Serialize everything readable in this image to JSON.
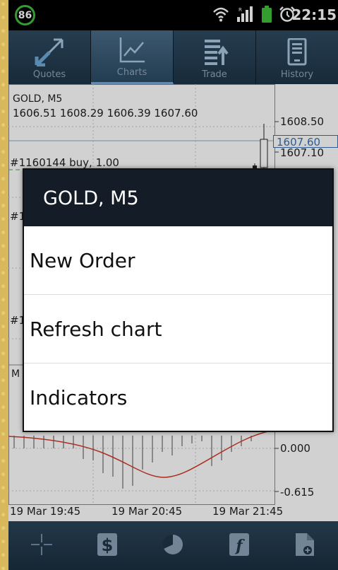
{
  "status_bar": {
    "battery_level": "86",
    "time": "22:15",
    "icons": [
      "wifi-icon",
      "signal-icon",
      "battery-icon",
      "alarm-icon"
    ]
  },
  "tabs": [
    {
      "label": "Quotes",
      "icon": "quotes-icon",
      "active": false
    },
    {
      "label": "Charts",
      "icon": "chart-icon",
      "active": true
    },
    {
      "label": "Trade",
      "icon": "trade-icon",
      "active": false
    },
    {
      "label": "History",
      "icon": "history-icon",
      "active": false
    }
  ],
  "chart": {
    "symbol_timeframe": "GOLD, M5",
    "ohlc": "1606.51 1608.29 1606.39 1607.60",
    "order_line_label": "#1160144 buy, 1.00",
    "partial_labels": [
      "#1",
      "#1",
      "M"
    ],
    "price_axis": [
      "1608.50",
      "1607.60",
      "1607.10"
    ],
    "indicator_axis": [
      "0.000",
      "-0.615"
    ],
    "time_axis": [
      "19 Mar 19:45",
      "19 Mar 20:45",
      "19 Mar 21:45"
    ]
  },
  "chart_data": {
    "type": "bar",
    "title": "GOLD, M5",
    "subtitle": "1606.51 1608.29 1606.39 1607.60",
    "price_ticks": [
      1608.5,
      1607.1
    ],
    "current_price": 1607.6,
    "indicator_ticks": [
      0.0,
      -0.615
    ],
    "x_ticks": [
      "19 Mar 19:45",
      "19 Mar 20:45",
      "19 Mar 21:45"
    ],
    "grid": true
  },
  "dialog": {
    "title": "GOLD, M5",
    "items": [
      "New Order",
      "Refresh chart",
      "Indicators"
    ]
  },
  "toolbar": {
    "icons": [
      "crosshair-icon",
      "dollar-icon",
      "period-clock-icon",
      "indicator-function-icon",
      "add-object-icon"
    ]
  },
  "colors": {
    "status_bar": "#000000",
    "battery_ring": "#3fc03a",
    "tab_bar": "#243d51",
    "dialog_title_bg": "#141c27",
    "price_tag": "#3a6fb0",
    "indicator_line": "#d23a2a"
  }
}
